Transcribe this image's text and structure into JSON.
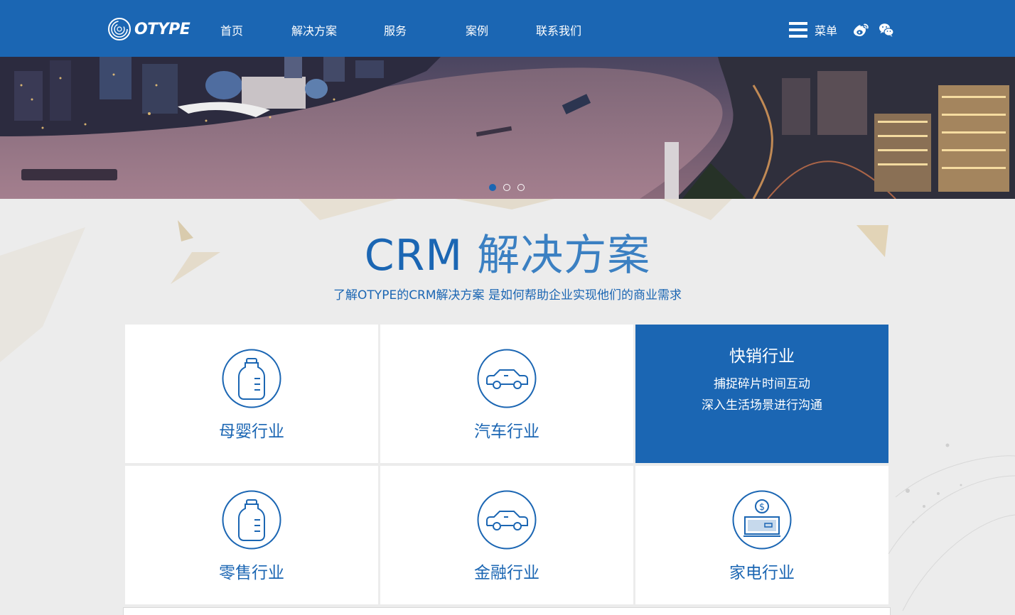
{
  "brand": {
    "logo_text": "OTYPE"
  },
  "nav": [
    {
      "label": "首页"
    },
    {
      "label": "解决方案"
    },
    {
      "label": "服务"
    },
    {
      "label": "案例"
    },
    {
      "label": "联系我们"
    }
  ],
  "header_right": {
    "menu_label": "菜单",
    "icons": [
      "menu-icon",
      "weibo-icon",
      "wechat-icon"
    ]
  },
  "banner": {
    "slides": 3,
    "active_slide": 1
  },
  "section": {
    "title_en": "CRM",
    "title_zh": "解决方案",
    "subtitle": "了解OTYPE的CRM解决方案 是如何帮助企业实现他们的商业需求"
  },
  "industries": [
    {
      "label": "母婴行业",
      "icon": "baby-bottle-icon"
    },
    {
      "label": "汽车行业",
      "icon": "car-icon"
    },
    {
      "label": "快销行业",
      "icon": "",
      "active": true,
      "desc": [
        "捕捉碎片时间互动",
        "深入生活场景进行沟通"
      ]
    },
    {
      "label": "零售行业",
      "icon": "baby-bottle-icon"
    },
    {
      "label": "金融行业",
      "icon": "car-icon"
    },
    {
      "label": "家电行业",
      "icon": "money-card-icon"
    }
  ],
  "colors": {
    "primary": "#1b66b3",
    "background": "#ececec",
    "card": "#ffffff"
  }
}
